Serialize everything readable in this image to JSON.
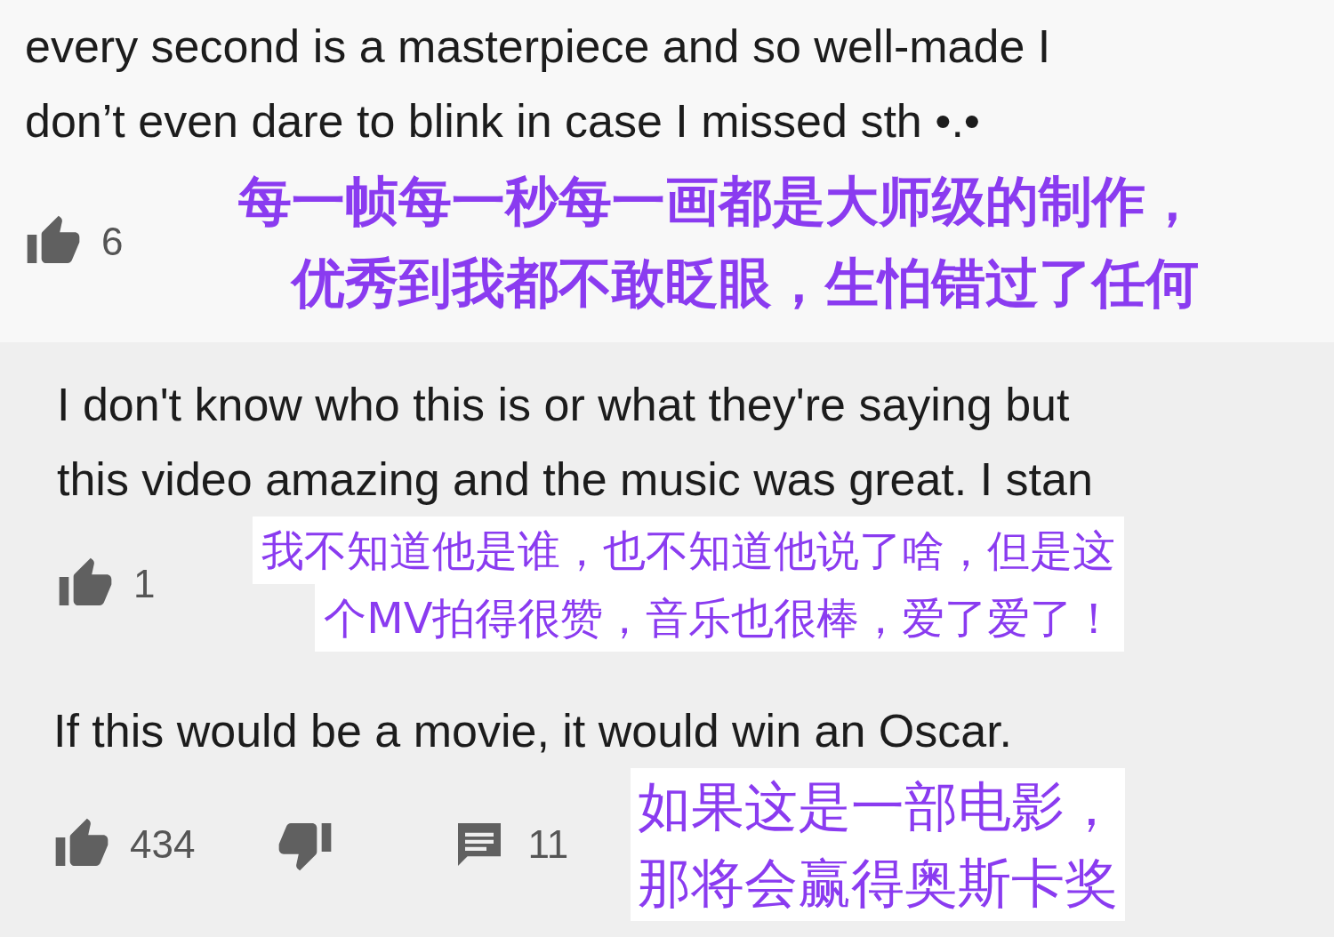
{
  "comments": [
    {
      "text": "every second is a masterpiece and so well-made I don’t even dare to blink in case I missed sth •.•",
      "likes": "6",
      "kind": "bold",
      "translation": [
        "每一帧每一秒每一画都是大师级的制作，",
        "优秀到我都不敢眨眼，生怕错过了任何"
      ]
    },
    {
      "text": "I don't know who this is or what they're saying but this video amazing and the music was great. I stan",
      "likes": "1",
      "kind": "boxed",
      "translation": [
        "我不知道他是谁，也不知道他说了啥，但是这",
        "个MV拍得很赞，音乐也很棒，爱了爱了！"
      ]
    },
    {
      "text": "If this would be a movie, it would win an Oscar.",
      "likes": "434",
      "replies": "11",
      "kind": "boxed-large",
      "translation": [
        "如果这是一部电影，",
        "那将会赢得奥斯卡奖"
      ]
    }
  ]
}
